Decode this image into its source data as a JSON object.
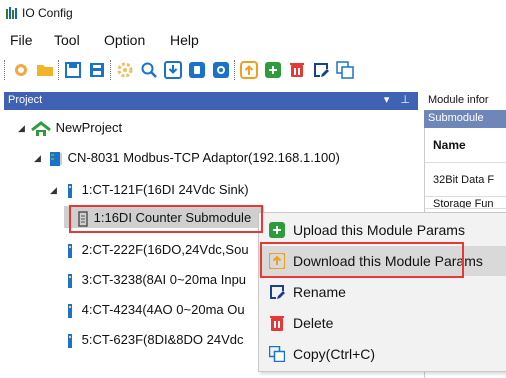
{
  "window": {
    "title": "IO Config"
  },
  "menu": [
    "File",
    "Tool",
    "Option",
    "Help"
  ],
  "toolbar": {
    "icons": [
      "connect-icon",
      "open-folder-icon",
      "save-icon",
      "save-as-icon",
      "settings-icon",
      "search-icon",
      "download-icon",
      "start-icon",
      "stop-icon",
      "upload-icon",
      "sync-icon",
      "delete-icon",
      "rename-icon",
      "copy-icon"
    ]
  },
  "project_panel": {
    "title": "Project",
    "pin_icons": "▾ ⊥"
  },
  "tree": {
    "root": "NewProject",
    "adaptor": "CN-8031 Modbus-TCP Adaptor(192.168.1.100)",
    "modules": [
      "1:CT-121F(16DI 24Vdc Sink)",
      "1:16DI Counter Submodule",
      "2:CT-222F(16DO,24Vdc,Sou",
      "3:CT-3238(8AI 0~20ma Inpu",
      "4:CT-4234(4AO 0~20ma Ou",
      "5:CT-623F(8DI&8DO 24Vdc"
    ]
  },
  "right_panel": {
    "header": "Module infor",
    "sub": "Submodule",
    "col_name": "Name",
    "row1": "32Bit Data F",
    "row2": "Storage Fun"
  },
  "context_menu": [
    {
      "label": "Upload this Module Params",
      "icon": "upload-params-icon"
    },
    {
      "label": "Download this Module Params",
      "icon": "download-params-icon"
    },
    {
      "label": "Rename",
      "icon": "rename-icon"
    },
    {
      "label": "Delete",
      "icon": "delete-icon"
    },
    {
      "label": "Copy(Ctrl+C)",
      "icon": "copy-icon"
    }
  ],
  "colors": {
    "panel_header": "#3f62b5",
    "highlight": "#e53935",
    "selection": "#cfcfcf",
    "menu_hover": "#d9d9d9"
  }
}
